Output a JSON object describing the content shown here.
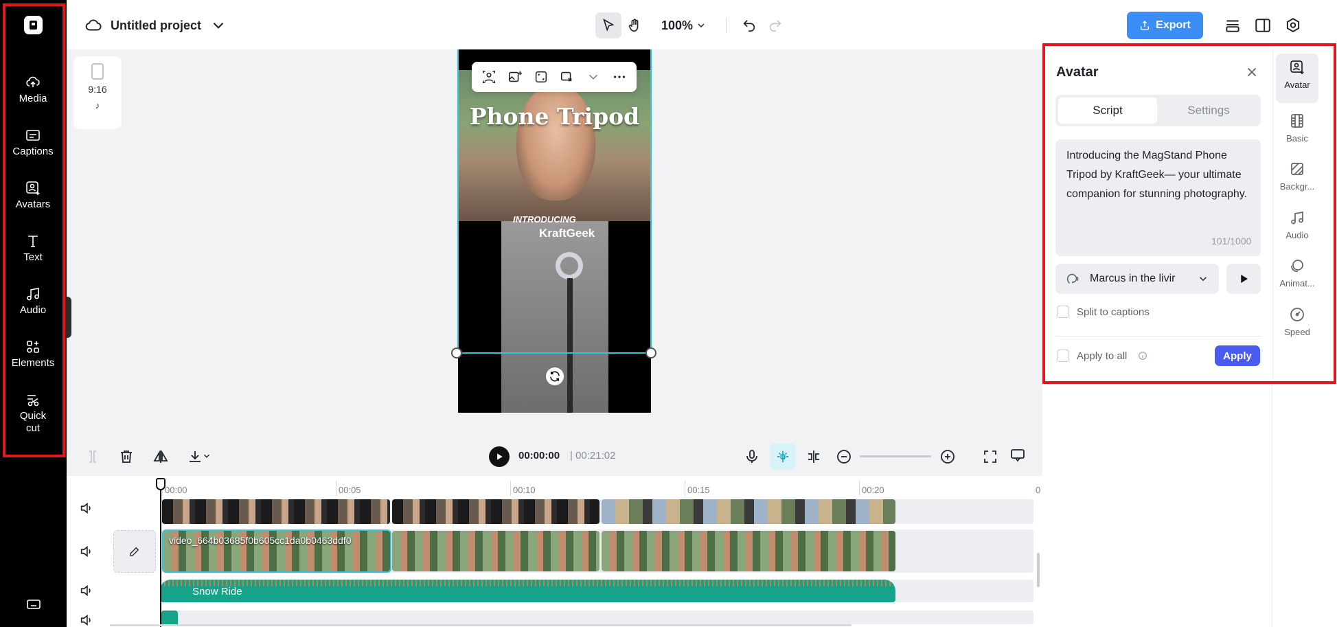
{
  "rail": {
    "items": [
      {
        "label": "Media",
        "icon": "cloud-upload-icon"
      },
      {
        "label": "Captions",
        "icon": "captions-icon"
      },
      {
        "label": "Avatars",
        "icon": "avatar-icon"
      },
      {
        "label": "Text",
        "icon": "text-icon"
      },
      {
        "label": "Audio",
        "icon": "music-note-icon"
      },
      {
        "label": "Elements",
        "icon": "elements-icon"
      },
      {
        "label": "Quick\ncut",
        "icon": "scissors-icon"
      }
    ]
  },
  "header": {
    "project_title": "Untitled project",
    "zoom": "100%",
    "export_label": "Export"
  },
  "canvas": {
    "ratio": "9:16",
    "video_title": "Phone Tripod",
    "overlay_small": "INTRODUCING",
    "overlay_brand": "KraftGeek"
  },
  "timeline": {
    "current_time": "00:00:00",
    "duration": "00:21:02",
    "ruler": [
      "00:00",
      "00:05",
      "00:10",
      "00:15",
      "00:20",
      "0"
    ],
    "main_clip_name": "video_664b03685f0b605cc1da0b0463ddf0",
    "audio_clip_name": "Snow Ride"
  },
  "panel": {
    "title": "Avatar",
    "tabs": [
      "Script",
      "Settings"
    ],
    "active_tab": "Script",
    "script_text": "Introducing the MagStand Phone Tripod by KraftGeek— your ultimate companion for stunning photography.",
    "char_count": "101/1000",
    "voice_name": "Marcus in the livir",
    "split_label": "Split to captions",
    "apply_all_label": "Apply to all",
    "apply_label": "Apply"
  },
  "right_tabs": [
    {
      "label": "Avatar",
      "icon": "avatar-icon"
    },
    {
      "label": "Basic",
      "icon": "film-icon"
    },
    {
      "label": "Backgr...",
      "icon": "background-icon"
    },
    {
      "label": "Audio",
      "icon": "music-note-icon"
    },
    {
      "label": "Animat...",
      "icon": "animation-icon"
    },
    {
      "label": "Speed",
      "icon": "speed-icon"
    }
  ],
  "colors": {
    "accent_export": "#3a8ef6",
    "apply_button": "#4a5cf0",
    "highlight_border": "#e0181e",
    "selection": "#33c3d8",
    "audio_track": "#16a389"
  }
}
